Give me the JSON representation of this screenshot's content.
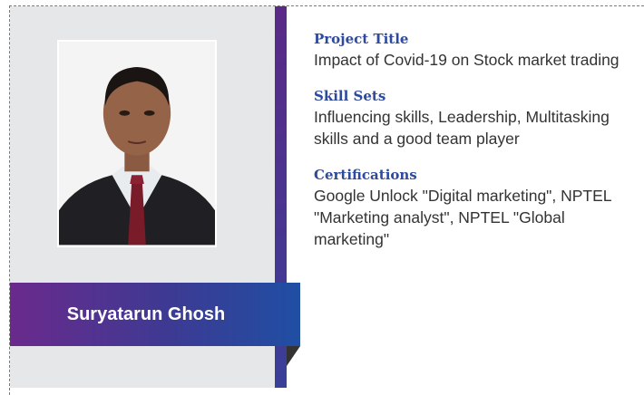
{
  "profile": {
    "name": "Suryatarun Ghosh",
    "photo_alt": "Portrait photo"
  },
  "sections": [
    {
      "heading": "Project Title",
      "text": "Impact of Covid-19 on Stock market trading"
    },
    {
      "heading": "Skill Sets",
      "text": "Influencing skills, Leadership, Multitasking skills and a good team player"
    },
    {
      "heading": "Certifications",
      "text": "Google Unlock \"Digital marketing\", NPTEL \"Marketing analyst\", NPTEL \"Global marketing\""
    }
  ],
  "colors": {
    "heading": "#2e4a9e",
    "panel": "#e6e7e9",
    "banner_start": "#6a2a8c",
    "banner_end": "#1f4fa3"
  }
}
